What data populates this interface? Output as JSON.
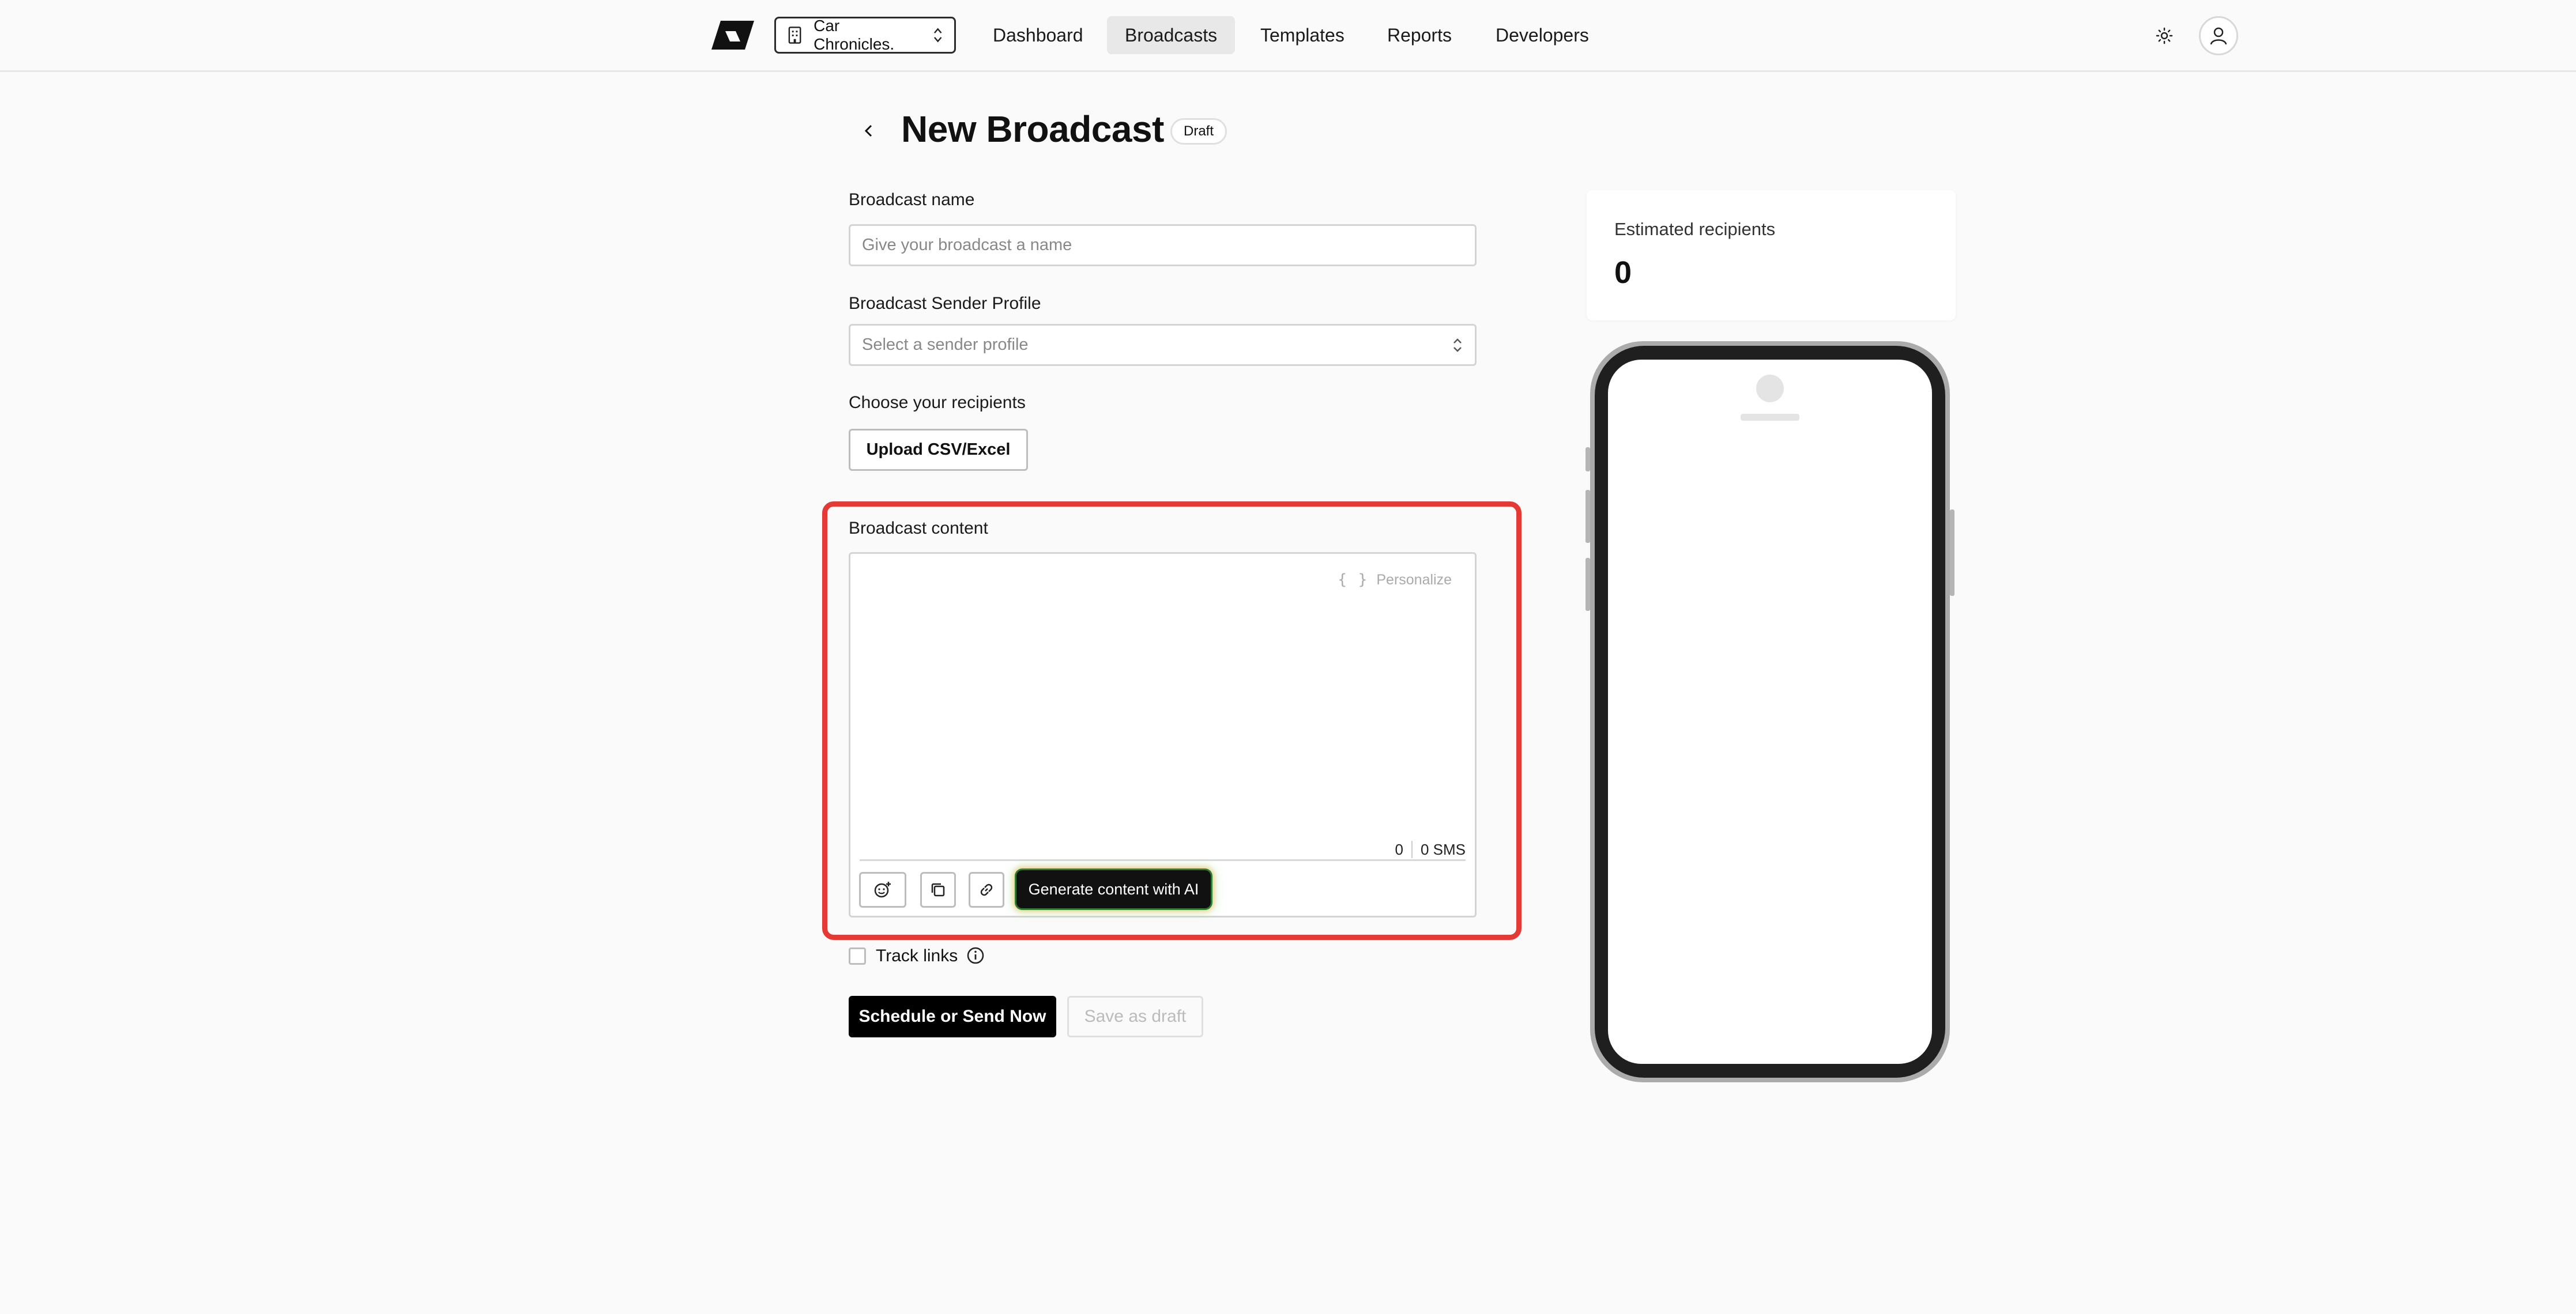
{
  "nav": {
    "org_name": "Car Chronicles.",
    "items": [
      {
        "label": "Dashboard",
        "active": false
      },
      {
        "label": "Broadcasts",
        "active": true
      },
      {
        "label": "Templates",
        "active": false
      },
      {
        "label": "Reports",
        "active": false
      },
      {
        "label": "Developers",
        "active": false
      }
    ]
  },
  "header": {
    "title": "New Broadcast",
    "status_badge": "Draft"
  },
  "form": {
    "name_label": "Broadcast name",
    "name_placeholder": "Give your broadcast a name",
    "name_value": "",
    "sender_label": "Broadcast Sender Profile",
    "sender_placeholder": "Select a sender profile",
    "recipients_label": "Choose your recipients",
    "upload_label": "Upload CSV/Excel",
    "content_label": "Broadcast content",
    "personalize_label": "Personalize",
    "char_count": "0",
    "sms_count": "0 SMS",
    "ai_button_label": "Generate content with AI",
    "track_links_label": "Track links",
    "track_links_checked": false,
    "primary_button": "Schedule or Send Now",
    "secondary_button": "Save as draft"
  },
  "preview": {
    "estimated_label": "Estimated recipients",
    "estimated_value": "0"
  },
  "colors": {
    "highlight": "#e53935",
    "primary": "#000000",
    "background": "#fafafa"
  }
}
